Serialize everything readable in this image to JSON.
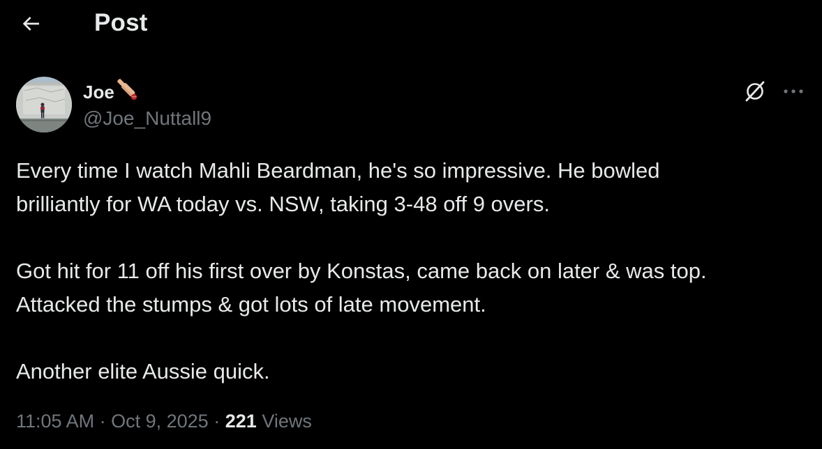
{
  "header": {
    "title": "Post",
    "back_icon": "arrow-left-icon"
  },
  "author": {
    "name": "Joe",
    "name_emoji": "cricket-bat-and-ball-icon",
    "handle": "@Joe_Nuttall9",
    "avatar": "user-avatar-photo"
  },
  "actions": {
    "grok_icon": "grok-icon",
    "more_icon": "more-horizontal-icon"
  },
  "post": {
    "line1": "Every time I watch Mahli Beardman, he's so impressive. He bowled",
    "line2": "brilliantly for WA today vs. NSW, taking 3-48 off 9 overs.",
    "line3": "Got hit for 11 off his first over by Konstas, came back on later & was top.",
    "line4": "Attacked the stumps & got lots of late movement.",
    "line5": "Another elite Aussie quick."
  },
  "meta": {
    "time": "11:05 AM",
    "separator": "·",
    "date": "Oct 9, 2025",
    "views_count": "221",
    "views_label": "Views"
  },
  "colors": {
    "background": "#000000",
    "primary_text": "#e7e9ea",
    "secondary_text": "#71767b"
  }
}
